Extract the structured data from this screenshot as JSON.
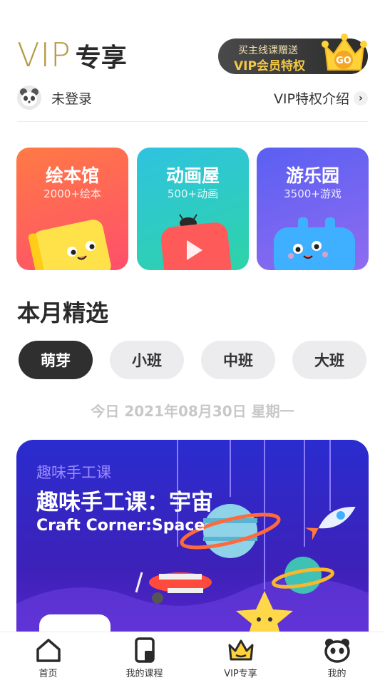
{
  "header": {
    "vip": "VIP",
    "zone": "专享",
    "promo_line1": "买主线课赠送",
    "promo_line2": "VIP会员特权",
    "promo_go": "GO"
  },
  "user": {
    "login_text": "未登录",
    "vip_intro": "VIP特权介绍"
  },
  "categories": [
    {
      "title": "绘本馆",
      "subtitle": "2000+绘本"
    },
    {
      "title": "动画屋",
      "subtitle": "500+动画"
    },
    {
      "title": "游乐园",
      "subtitle": "3500+游戏"
    }
  ],
  "section_title": "本月精选",
  "tabs": [
    "萌芽",
    "小班",
    "中班",
    "大班"
  ],
  "active_tab": "萌芽",
  "date_text": "今日 2021年08月30日 星期一",
  "banner": {
    "subtitle": "趣味手工课",
    "title": "趣味手工课：宇宙",
    "english": "Craft Corner:Space"
  },
  "nav": [
    "首页",
    "我的课程",
    "VIP专享",
    "我的"
  ],
  "colors": {
    "gold": "#b39a45",
    "card1": "#ff5f5f",
    "card2": "#2fc9c8",
    "card3": "#6a63f1",
    "banner": "#2a2ccf"
  }
}
